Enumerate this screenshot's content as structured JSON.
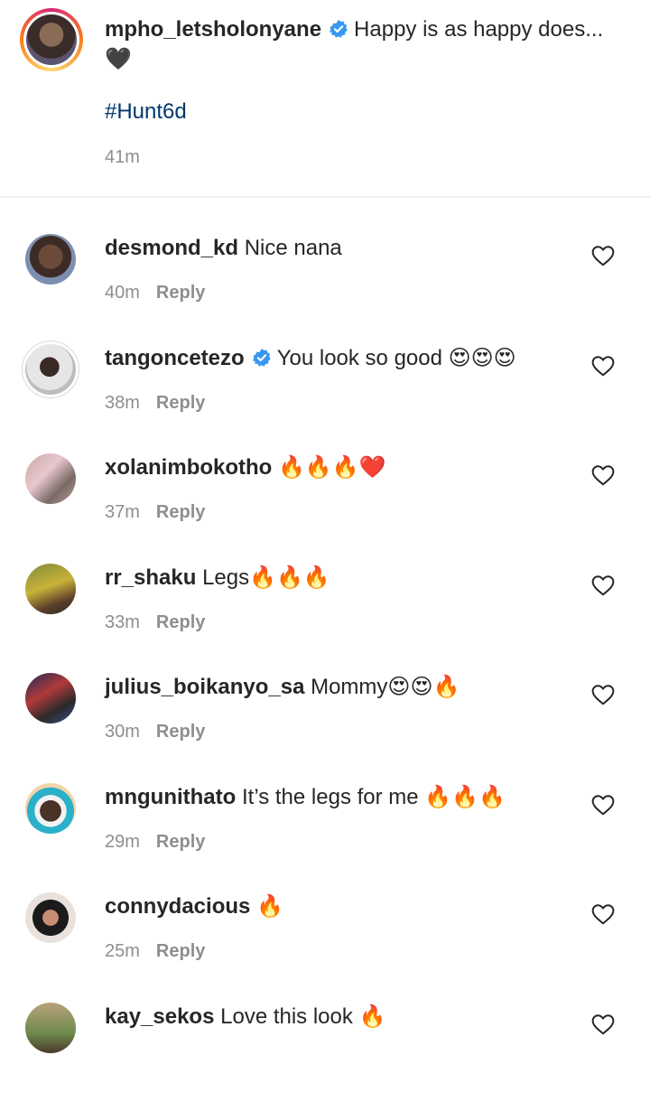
{
  "caption": {
    "username": "mpho_letsholonyane",
    "text": "Happy is as happy does...",
    "emoji": "🖤",
    "hashtag": "#Hunt6d",
    "time": "41m"
  },
  "comments": [
    {
      "username": "desmond_kd",
      "text": "Nice nana",
      "emoji": "",
      "time": "40m",
      "reply": "Reply",
      "verified": false
    },
    {
      "username": "tangoncetezo",
      "text": "You look so good",
      "emoji": "😍😍😍",
      "time": "38m",
      "reply": "Reply",
      "verified": true
    },
    {
      "username": "xolanimbokotho",
      "text": "",
      "emoji": "🔥🔥🔥❤️",
      "time": "37m",
      "reply": "Reply",
      "verified": false
    },
    {
      "username": "rr_shaku",
      "text": "Legs",
      "emoji": "🔥🔥🔥",
      "time": "33m",
      "reply": "Reply",
      "verified": false
    },
    {
      "username": "julius_boikanyo_sa",
      "text": "Mommy",
      "emoji": "😍😍🔥",
      "time": "30m",
      "reply": "Reply",
      "verified": false
    },
    {
      "username": "mngunithato",
      "text": "It’s the legs for me",
      "emoji": "🔥🔥🔥",
      "time": "29m",
      "reply": "Reply",
      "verified": false
    },
    {
      "username": "connydacious",
      "text": "",
      "emoji": "🔥",
      "time": "25m",
      "reply": "Reply",
      "verified": false
    },
    {
      "username": "kay_sekos",
      "text": "Love this look",
      "emoji": "🔥",
      "time": "",
      "reply": "",
      "verified": false
    }
  ],
  "colors": {
    "text": "#262626",
    "muted": "#8e8e8e",
    "hashtag": "#00376b",
    "verified": "#3897f0"
  },
  "icons": {
    "like": "heart-outline-icon",
    "verified": "verified-badge-icon"
  }
}
